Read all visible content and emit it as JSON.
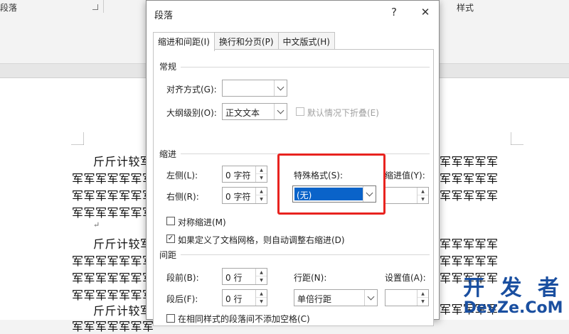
{
  "ribbon": {
    "group_left": "段落",
    "group_right": "样式"
  },
  "dialog": {
    "title": "段落",
    "help": "?",
    "close": "✕",
    "tabs": [
      {
        "label": "缩进和间距(I)"
      },
      {
        "label": "换行和分页(P)"
      },
      {
        "label": "中文版式(H)"
      }
    ],
    "general": {
      "heading": "常规",
      "align_label": "对齐方式(G):",
      "align_value": "",
      "outline_label": "大纲级别(O):",
      "outline_value": "正文文本",
      "collapse_label": "默认情况下折叠(E)"
    },
    "indent": {
      "heading": "缩进",
      "left_label": "左侧(L):",
      "left_value": "0 字符",
      "right_label": "右侧(R):",
      "right_value": "0 字符",
      "special_label": "特殊格式(S):",
      "special_value": "(无)",
      "amount_label": "缩进值(Y):",
      "amount_value": "",
      "mirror_label": "对称缩进(M)",
      "auto_adjust_label": "如果定义了文档网格，则自动调整右缩进(D)"
    },
    "spacing": {
      "heading": "间距",
      "before_label": "段前(B):",
      "before_value": "0 行",
      "after_label": "段后(F):",
      "after_value": "0 行",
      "line_label": "行距(N):",
      "line_value": "单倍行距",
      "at_label": "设置值(A):",
      "at_value": "",
      "no_space_label": "在相同样式的段落间不添加空格(C)"
    }
  },
  "document": {
    "lines": [
      {
        "left": "斤斤计较军",
        "right": "军军军军军"
      },
      {
        "left": "军军军军军军军",
        "right": "军军军军军"
      },
      {
        "left": "军军军军军军军",
        "right": "军军军军军"
      },
      {
        "left": "军军军军军军军",
        "right": ""
      },
      {
        "left": "↵",
        "right": ""
      },
      {
        "left": "斤斤计较军",
        "right": "军军军军军"
      },
      {
        "left": "军军军军军军军",
        "right": "军军军军军"
      },
      {
        "left": "军军军军军军军",
        "right": "军军军军军"
      },
      {
        "left": "军军军军军军军",
        "right": ""
      },
      {
        "left": "斤斤计较军",
        "right": ""
      },
      {
        "left": "军军军军军军军",
        "right": "军军军军军"
      }
    ]
  },
  "watermark": {
    "cn": "开 发 者",
    "en": "DevZe.CoM"
  },
  "colors": {
    "highlight": "#0a63c9",
    "annotation_box": "#e8231f",
    "watermark": "#1a4fa0"
  }
}
